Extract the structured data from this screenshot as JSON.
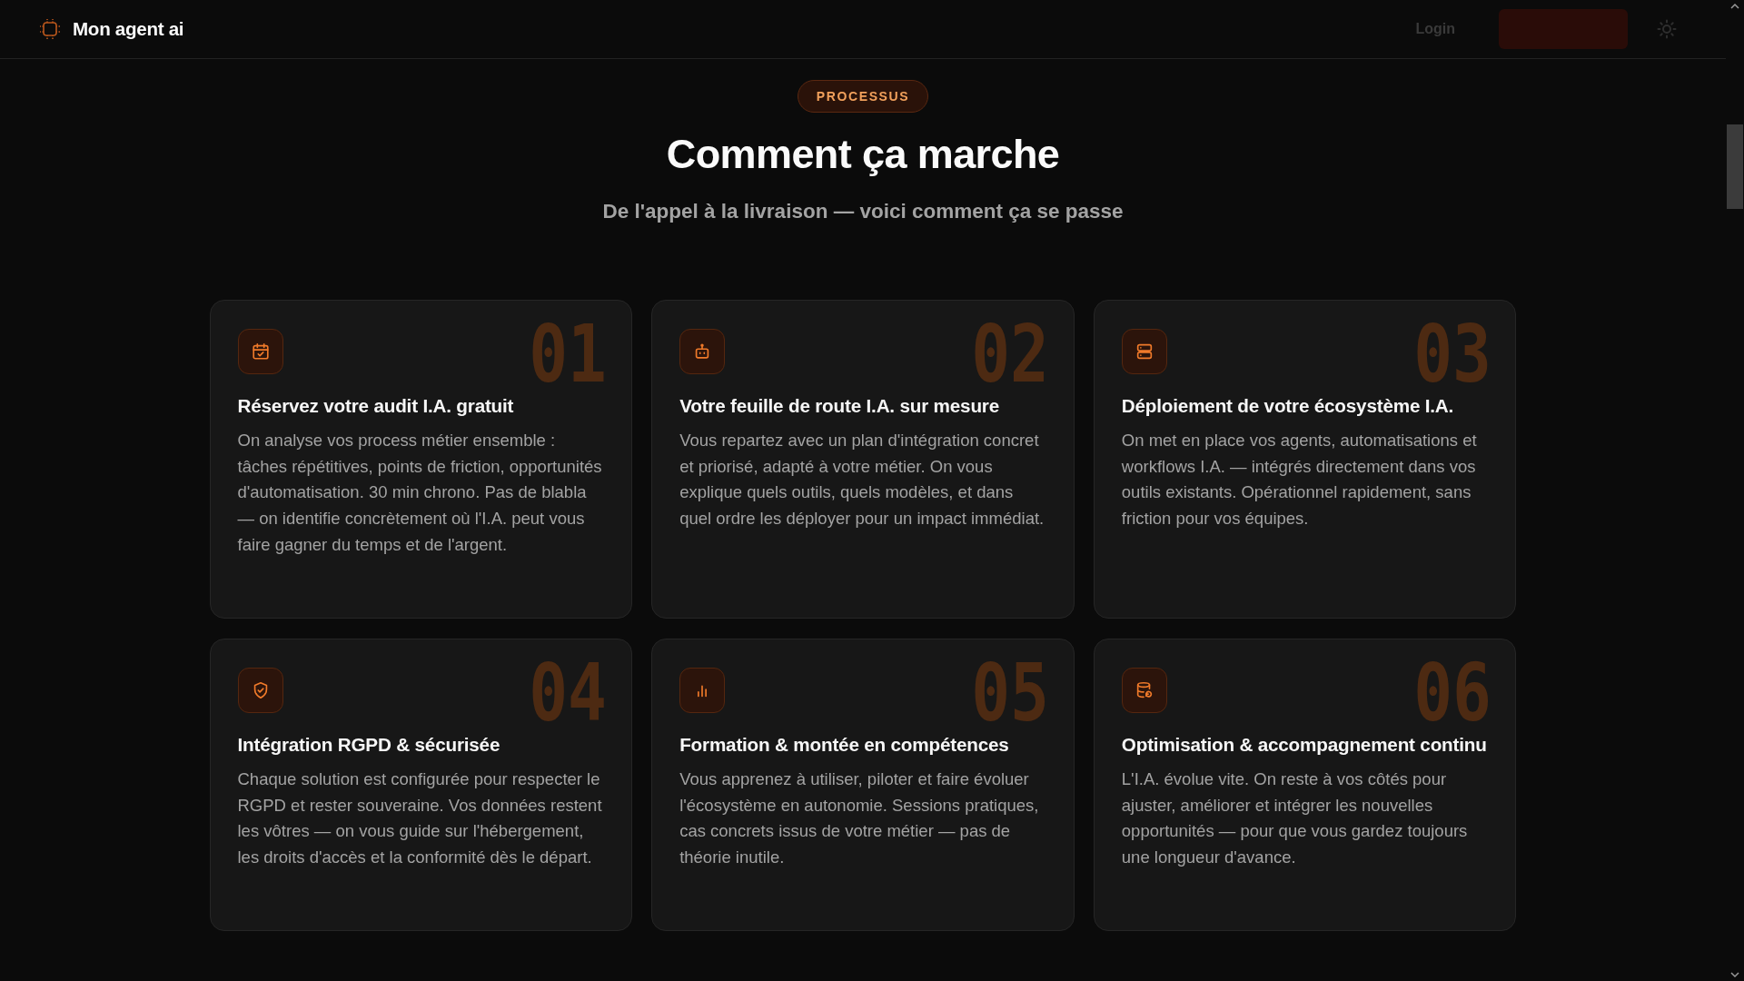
{
  "header": {
    "brand": "Mon agent ai",
    "login": "Login"
  },
  "section": {
    "badge": "PROCESSUS",
    "title": "Comment ça marche",
    "subtitle": "De l'appel à la livraison — voici comment ça se passe"
  },
  "steps": [
    {
      "number": "01",
      "title": "Réservez votre audit I.A. gratuit",
      "text": "On analyse vos process métier ensemble : tâches répétitives, points de friction, opportunités d'automatisation. 30 min chrono. Pas de blabla — on identifie concrètement où l'I.A. peut vous faire gagner du temps et de l'argent."
    },
    {
      "number": "02",
      "title": "Votre feuille de route I.A. sur mesure",
      "text": "Vous repartez avec un plan d'intégration concret et priorisé, adapté à votre métier. On vous explique quels outils, quels modèles, et dans quel ordre les déployer pour un impact immédiat."
    },
    {
      "number": "03",
      "title": "Déploiement de votre écosystème I.A.",
      "text": "On met en place vos agents, automatisations et workflows I.A. — intégrés directement dans vos outils existants. Opérationnel rapidement, sans friction pour vos équipes."
    },
    {
      "number": "04",
      "title": "Intégration RGPD & sécurisée",
      "text": "Chaque solution est configurée pour respecter le RGPD et rester souveraine. Vos données restent les vôtres — on vous guide sur l'hébergement, les droits d'accès et la conformité dès le départ."
    },
    {
      "number": "05",
      "title": "Formation & montée en compétences",
      "text": "Vous apprenez à utiliser, piloter et faire évoluer l'écosystème en autonomie. Sessions pratiques, cas concrets issus de votre métier — pas de théorie inutile."
    },
    {
      "number": "06",
      "title": "Optimisation & accompagnement continu",
      "text": "L'I.A. évolue vite. On reste à vos côtés pour ajuster, améliorer et intégrer les nouvelles opportunités — pour que vous gardez toujours une longueur d'avance."
    }
  ]
}
